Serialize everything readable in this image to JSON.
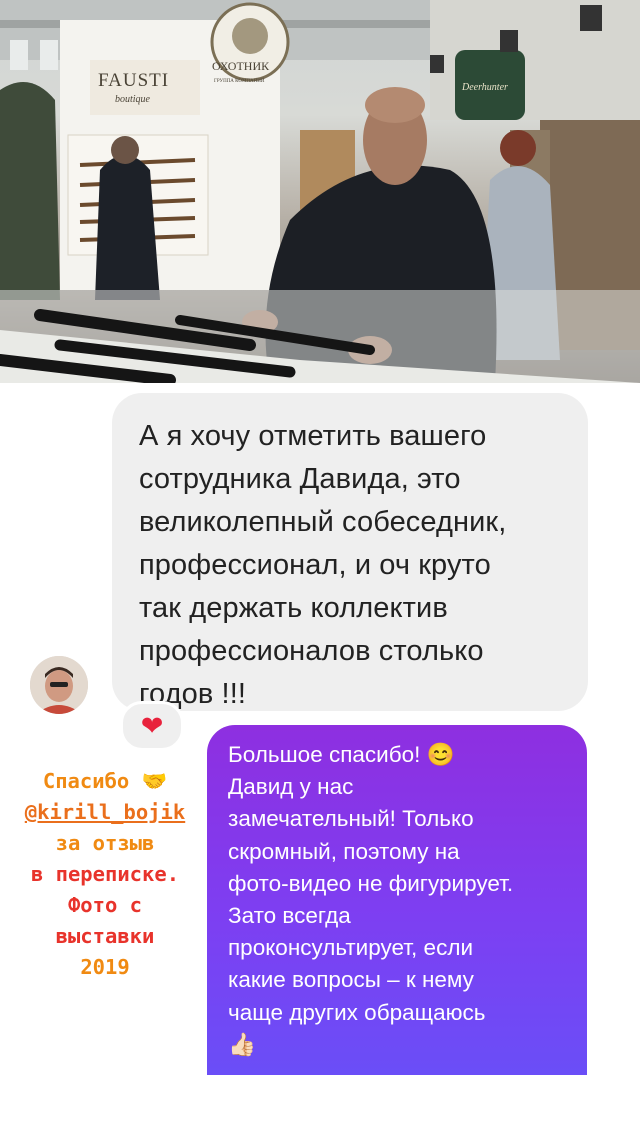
{
  "photo": {
    "signs": {
      "fausti": "FAUSTI",
      "fausti_sub": "boutique",
      "ohotnik": "ОХОТНИК",
      "ohotnik_sub": "ГРУППА КОМПАНИЙ",
      "deerhunter": "Deerhunter"
    }
  },
  "incoming_message": {
    "lines": [
      "А я хочу отметить вашего",
      "сотрудника Давида,  это",
      "великолепный собеседник,",
      "профессионал, и оч круто",
      "так держать коллектив",
      "профессионалов столько",
      "годов !!!"
    ],
    "reaction": "❤"
  },
  "outgoing_message": {
    "lines": [
      "Большое спасибо! 😊",
      "Давид у нас",
      "замечательный! Только",
      "скромный, поэтому на",
      "фото-видео не фигурирует.",
      "Зато всегда",
      "проконсультирует, если",
      "какие вопросы – к нему",
      "чаще других обращаюсь",
      "👍🏻"
    ]
  },
  "caption": {
    "line1": "Спасибо 🤝",
    "handle": "@kirill_bojik",
    "line3": "за отзыв",
    "line4": "в переписке.",
    "line5": "Фото с",
    "line6": "выставки",
    "line7": "2019"
  }
}
